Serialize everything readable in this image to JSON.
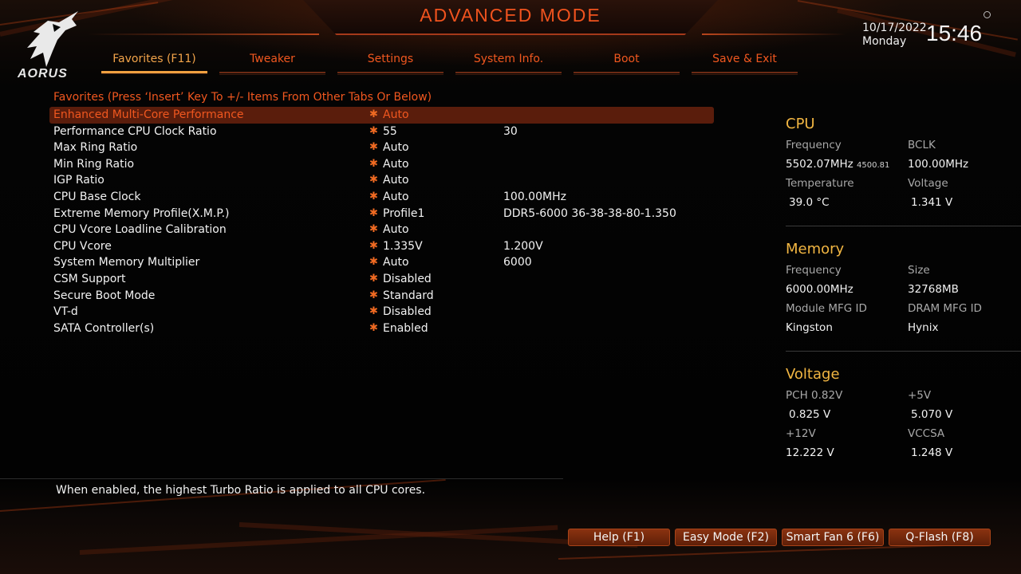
{
  "header": {
    "title": "ADVANCED MODE",
    "logo_text": "AORUS",
    "date": "10/17/2022",
    "day": "Monday",
    "time": "15:46"
  },
  "tabs": [
    {
      "label": "Favorites (F11)",
      "active": true
    },
    {
      "label": "Tweaker"
    },
    {
      "label": "Settings"
    },
    {
      "label": "System Info."
    },
    {
      "label": "Boot"
    },
    {
      "label": "Save & Exit"
    }
  ],
  "favorites": {
    "title": "Favorites (Press ‘Insert’ Key To +/- Items From Other Tabs Or Below)",
    "items": [
      {
        "label": "Enhanced Multi-Core Performance",
        "value": "Auto",
        "current": "",
        "selected": true
      },
      {
        "label": "Performance CPU Clock Ratio",
        "value": "55",
        "current": "30"
      },
      {
        "label": "Max Ring Ratio",
        "value": "Auto",
        "current": ""
      },
      {
        "label": "Min Ring Ratio",
        "value": "Auto",
        "current": ""
      },
      {
        "label": "IGP Ratio",
        "value": "Auto",
        "current": ""
      },
      {
        "label": "CPU Base Clock",
        "value": "Auto",
        "current": "100.00MHz"
      },
      {
        "label": "Extreme Memory Profile(X.M.P.)",
        "value": "Profile1",
        "current": "DDR5-6000 36-38-38-80-1.350"
      },
      {
        "label": "CPU Vcore Loadline Calibration",
        "value": "Auto",
        "current": ""
      },
      {
        "label": "CPU Vcore",
        "value": "1.335V",
        "current": "1.200V"
      },
      {
        "label": "System Memory Multiplier",
        "value": "Auto",
        "current": "6000"
      },
      {
        "label": "CSM Support",
        "value": "Disabled",
        "current": ""
      },
      {
        "label": "Secure Boot Mode",
        "value": "Standard",
        "current": ""
      },
      {
        "label": "VT-d",
        "value": "Disabled",
        "current": ""
      },
      {
        "label": "SATA Controller(s)",
        "value": "Enabled",
        "current": ""
      }
    ],
    "star_glyph": "*"
  },
  "info": {
    "cpu": {
      "title": "CPU",
      "frequency_label": "Frequency",
      "frequency_value": "5502.07MHz",
      "frequency_sub": "4500.81",
      "bclk_label": "BCLK",
      "bclk_value": "100.00MHz",
      "temperature_label": "Temperature",
      "temperature_value": "39.0 °C",
      "voltage_label": "Voltage",
      "voltage_value": "1.341 V"
    },
    "memory": {
      "title": "Memory",
      "frequency_label": "Frequency",
      "frequency_value": "6000.00MHz",
      "size_label": "Size",
      "size_value": "32768MB",
      "module_label": "Module MFG ID",
      "module_value": "Kingston",
      "dram_label": "DRAM MFG ID",
      "dram_value": "Hynix"
    },
    "voltage": {
      "title": "Voltage",
      "pch_label": "PCH 0.82V",
      "pch_value": "0.825 V",
      "p5v_label": "+5V",
      "p5v_value": "5.070 V",
      "p12v_label": "+12V",
      "p12v_value": "12.222 V",
      "vccsa_label": "VCCSA",
      "vccsa_value": "1.248 V"
    }
  },
  "help_text": "When enabled, the highest Turbo Ratio is applied to all CPU cores.",
  "footer_buttons": [
    {
      "label": "Help (F1)"
    },
    {
      "label": "Easy Mode (F2)"
    },
    {
      "label": "Smart Fan 6 (F6)"
    },
    {
      "label": "Q-Flash (F8)"
    }
  ],
  "colors": {
    "accent_orange": "#f0571f",
    "title_gold": "#f2b642",
    "selected_row": "#5a1d0c"
  }
}
